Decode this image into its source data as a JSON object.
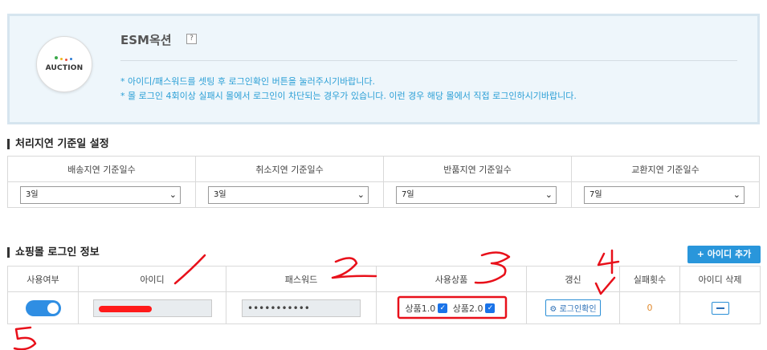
{
  "header": {
    "logo_text": "AUCTION",
    "market_title": "ESM옥션",
    "help_glyph": "?",
    "notices": [
      "* 아이디/패스워드를 셋팅 후 로그인확인 버튼을 눌러주시기바랍니다.",
      "* 몰 로그인 4회이상 실패시 몰에서 로그인이 차단되는 경우가 있습니다. 이런 경우 해당 몰에서 직접 로그인하시기바랍니다."
    ],
    "logo_dot_colors": [
      "#3aa84a",
      "#f2b51d",
      "#e94e3c",
      "#2b7bd3"
    ]
  },
  "delay_section": {
    "title": "처리지연 기준일 설정",
    "columns": [
      {
        "label": "배송지연 기준일수",
        "selected": "3일"
      },
      {
        "label": "취소지연 기준일수",
        "selected": "3일"
      },
      {
        "label": "반품지연 기준일수",
        "selected": "7일"
      },
      {
        "label": "교환지연 기준일수",
        "selected": "7일"
      }
    ]
  },
  "login_section": {
    "title": "쇼핑몰 로그인 정보",
    "add_button": "+ 아이디 추가",
    "headers": [
      "사용여부",
      "아이디",
      "패스워드",
      "사용상품",
      "갱신",
      "실패횟수",
      "아이디 삭제"
    ],
    "row": {
      "enabled": true,
      "password_mask": "•••••••••••",
      "product_1": "상품1.0",
      "product_2": "상품2.0",
      "login_check": "⚙ 로그인확인",
      "fail_count": "0"
    }
  },
  "colors": {
    "accent": "#2996db",
    "notice": "#2b9fd6",
    "annotation": "#e8101a"
  }
}
